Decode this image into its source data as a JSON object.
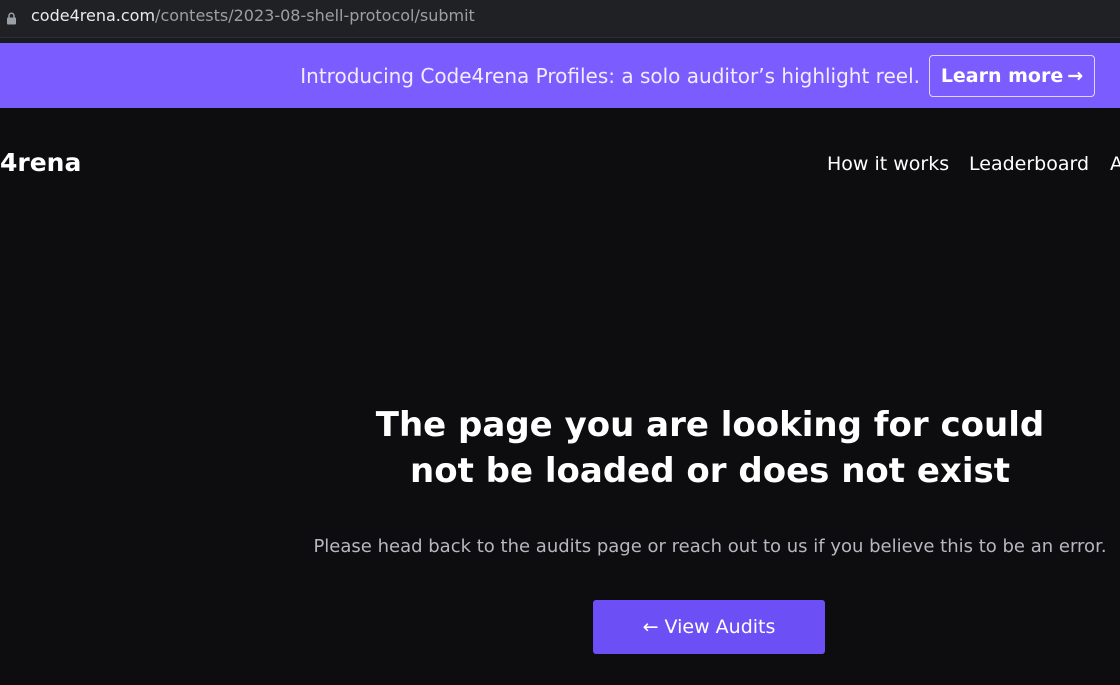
{
  "browser": {
    "url_domain": "code4rena.com",
    "url_path": "/contests/2023-08-shell-protocol/submit"
  },
  "banner": {
    "text": "Introducing Code4rena Profiles: a solo auditor’s highlight reel.",
    "learn_more_label": "Learn more",
    "learn_more_arrow": "→"
  },
  "nav": {
    "logo": "4rena",
    "links": [
      "How it works",
      "Leaderboard",
      "A"
    ]
  },
  "error": {
    "title": "The page you are looking for could not be loaded or does not exist",
    "message": "Please head back to the audits page or reach out to us if you believe this to be an error.",
    "button_arrow": "←",
    "button_label": "View Audits"
  },
  "colors": {
    "banner_bg": "#7b5cff",
    "button_bg": "#6c4ff5",
    "page_bg": "#0d0d10"
  }
}
